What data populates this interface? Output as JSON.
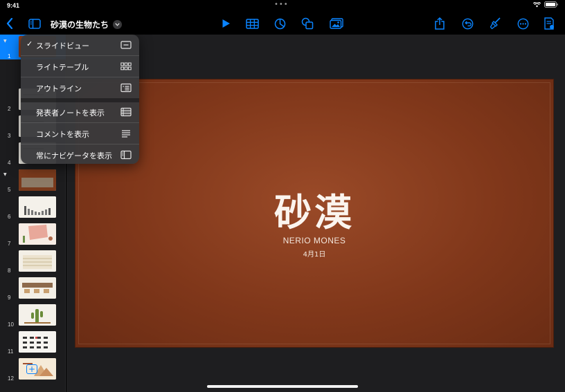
{
  "status": {
    "time": "9:41",
    "dots": "•••"
  },
  "toolbar": {
    "document_title": "砂漠の生物たち",
    "accent_color": "#0a84ff",
    "left_icons": [
      "back-chevron-icon",
      "sidebar-toggle-icon",
      "title-menu-chevron-icon"
    ],
    "center_icons": [
      "play-icon",
      "table-icon",
      "chart-icon",
      "shape-icon",
      "media-icon"
    ],
    "right_icons": [
      "share-icon",
      "undo-icon",
      "format-brush-icon",
      "more-icon",
      "presenter-doc-icon"
    ]
  },
  "navigator": {
    "slides": [
      {
        "num": "1",
        "type": "title",
        "selected": true
      },
      {
        "num": "2",
        "type": "text"
      },
      {
        "num": "3",
        "type": "text"
      },
      {
        "num": "4",
        "type": "text"
      },
      {
        "num": "5",
        "type": "photo"
      },
      {
        "num": "6",
        "type": "bar-chart"
      },
      {
        "num": "7",
        "type": "pink-illustration"
      },
      {
        "num": "8",
        "type": "table"
      },
      {
        "num": "9",
        "type": "timeline"
      },
      {
        "num": "10",
        "type": "cactus"
      },
      {
        "num": "11",
        "type": "animal-grid"
      },
      {
        "num": "12",
        "type": "desert-illustration"
      }
    ],
    "add_label": "+"
  },
  "slide": {
    "title": "砂漠",
    "author": "NERIO MONES",
    "date": "4月1日",
    "background_color": "#8a3e1e"
  },
  "view_menu": {
    "items": [
      {
        "label": "スライドビュー",
        "checked": true,
        "icon": "slide-view-icon"
      },
      {
        "label": "ライトテーブル",
        "checked": false,
        "icon": "light-table-icon"
      },
      {
        "label": "アウトライン",
        "checked": false,
        "icon": "outline-icon"
      },
      {
        "label": "発表者ノートを表示",
        "checked": false,
        "icon": "presenter-notes-icon"
      },
      {
        "label": "コメントを表示",
        "checked": false,
        "icon": "comments-icon"
      },
      {
        "label": "常にナビゲータを表示",
        "checked": false,
        "icon": "navigator-icon"
      }
    ],
    "check_mark": "✓"
  }
}
